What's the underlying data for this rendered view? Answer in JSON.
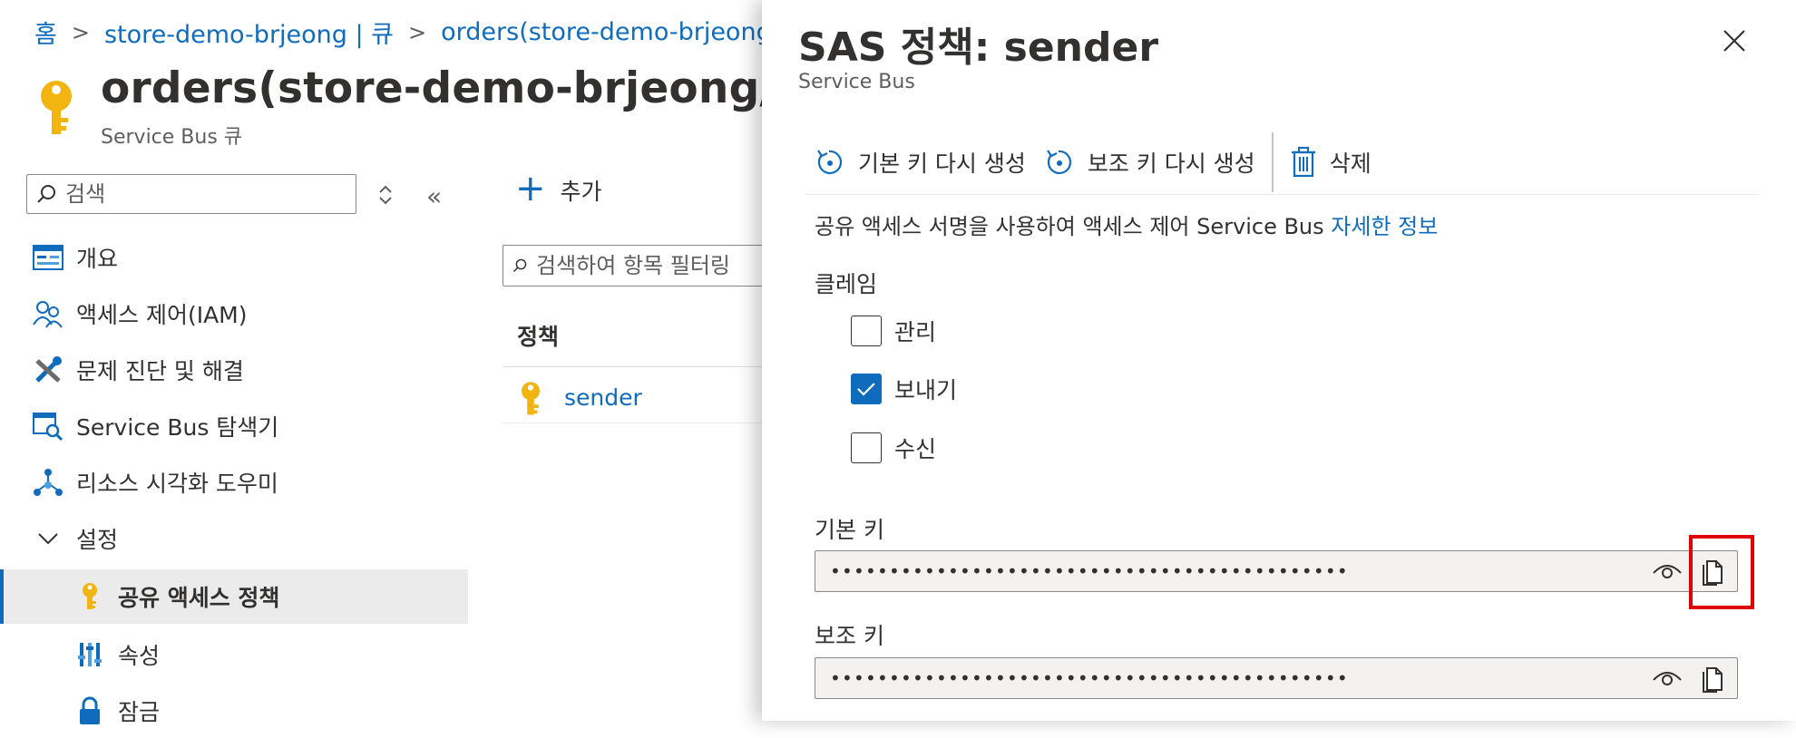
{
  "breadcrumb": {
    "home": "홈",
    "namespace": "store-demo-brjeong | 큐",
    "queue": "orders(store-demo-brjeong/orc"
  },
  "resource": {
    "title": "orders(store-demo-brjeong/orders",
    "subtitle": "Service Bus 큐"
  },
  "sidebar": {
    "search_placeholder": "검색",
    "items": [
      {
        "label": "개요",
        "icon": "overview-icon"
      },
      {
        "label": "액세스 제어(IAM)",
        "icon": "people-icon"
      },
      {
        "label": "문제 진단 및 해결",
        "icon": "wrench-icon"
      },
      {
        "label": "Service Bus 탐색기",
        "icon": "explorer-icon"
      },
      {
        "label": "리소스 시각화 도우미",
        "icon": "hierarchy-icon"
      },
      {
        "label": "설정",
        "icon": "chevron-down-icon"
      },
      {
        "label": "공유 액세스 정책",
        "icon": "key-icon",
        "selected": true
      },
      {
        "label": "속성",
        "icon": "properties-icon"
      },
      {
        "label": "잠금",
        "icon": "lock-icon"
      }
    ]
  },
  "main": {
    "add_label": "추가",
    "filter_placeholder": "검색하여 항목 필터링",
    "column_policy": "정책",
    "rows": [
      {
        "name": "sender"
      }
    ]
  },
  "panel": {
    "title": "SAS 정책: sender",
    "subtitle": "Service Bus",
    "toolbar": {
      "regen_primary": "기본 키 다시 생성",
      "regen_secondary": "보조 키 다시 생성",
      "delete": "삭제"
    },
    "description": "공유 액세스 서명을 사용하여 액세스 제어 Service Bus",
    "learn_more": "자세한 정보",
    "claims_label": "클레임",
    "claims": [
      {
        "label": "관리",
        "checked": false
      },
      {
        "label": "보내기",
        "checked": true
      },
      {
        "label": "수신",
        "checked": false
      }
    ],
    "primary_key_label": "기본 키",
    "primary_key_value": "••••••••••••••••••••••••••••••••••••••••••••",
    "secondary_key_label": "보조 키",
    "secondary_key_value": "••••••••••••••••••••••••••••••••••••••••••••"
  },
  "colors": {
    "accent": "#0f6cbd",
    "key_gold": "#f2b40f",
    "highlight": "#e00000",
    "selected_bg": "#ebebeb"
  }
}
